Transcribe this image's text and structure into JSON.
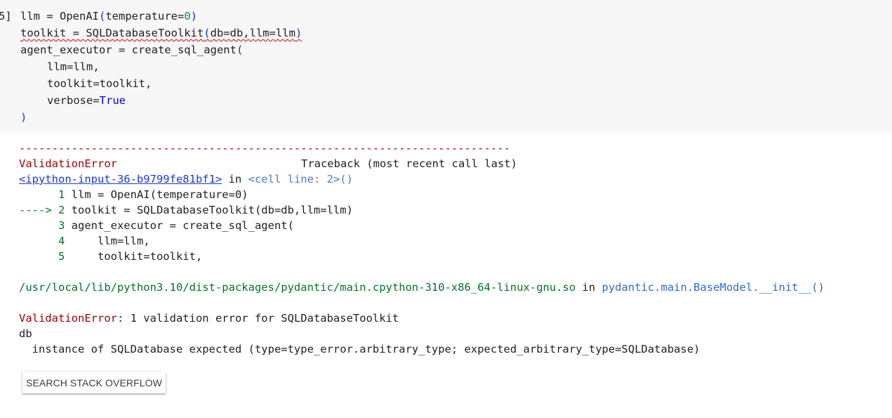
{
  "cell": {
    "prompt": "5]",
    "line1": {
      "a": "llm = OpenAI",
      "b": "(",
      "c": "temperature=",
      "d": "0",
      "e": ")"
    },
    "line2": {
      "a": "toolkit = SQLDatabaseToolkit",
      "b": "(",
      "c": "db=db,llm=llm",
      "d": ")"
    },
    "line3": {
      "a": "agent_executor = create_sql_agent",
      "b": "("
    },
    "line4": "llm=llm,",
    "line5": "toolkit=toolkit,",
    "line6": {
      "a": "verbose=",
      "b": "True"
    },
    "line7": ")"
  },
  "output": {
    "dashes": "---------------------------------------------------------------------------",
    "error_name": "ValidationError",
    "traceback_label": "Traceback (most recent call last)",
    "input_link": "<ipython-input-36-b9799fe81bf1>",
    "in_word": " in ",
    "cell_ref": "<cell line: 2>()",
    "tb_lines": [
      {
        "marker": "      1 ",
        "code": "llm = OpenAI(temperature=0)"
      },
      {
        "marker": "----> 2 ",
        "code": "toolkit = SQLDatabaseToolkit(db=db,llm=llm)"
      },
      {
        "marker": "      3 ",
        "code": "agent_executor = create_sql_agent("
      },
      {
        "marker": "      4 ",
        "code": "    llm=llm,"
      },
      {
        "marker": "      5 ",
        "code": "    toolkit=toolkit,"
      }
    ],
    "path": "/usr/local/lib/python3.10/dist-packages/pydantic/main.cpython-310-x86_64-linux-gnu.so",
    "path_in": " in ",
    "func": "pydantic.main.BaseModel.__init__()",
    "final_error_name": "ValidationError",
    "final_error_msg": ": 1 validation error for SQLDatabaseToolkit",
    "field": "db",
    "detail": "  instance of SQLDatabase expected (type=type_error.arbitrary_type; expected_arbitrary_type=SQLDatabase)"
  },
  "button": {
    "label": "SEARCH STACK OVERFLOW"
  }
}
